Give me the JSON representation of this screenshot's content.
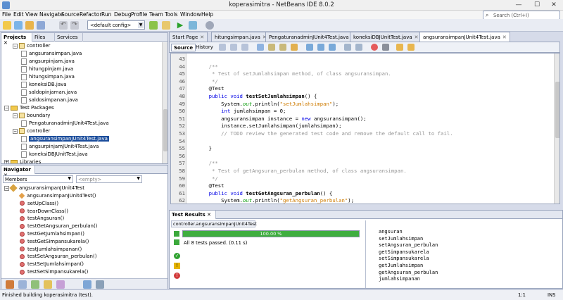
{
  "window": {
    "title": "koperasimitra - NetBeans IDE 8.0.2",
    "min": "—",
    "max": "☐",
    "close": "✕"
  },
  "menu": [
    "File",
    "Edit",
    "View",
    "Navigate",
    "Source",
    "Refactor",
    "Run",
    "Debug",
    "Profile",
    "Team",
    "Tools",
    "Window",
    "Help"
  ],
  "search": {
    "placeholder": "Search (Ctrl+I)"
  },
  "toolbar": {
    "config": "<default config>"
  },
  "projects_panel": {
    "tabs": [
      "Projects",
      "Files",
      "Services"
    ],
    "rows": [
      {
        "label": "controller",
        "type": "pkg",
        "indent": 2
      },
      {
        "label": "angsuransimpan.java",
        "type": "file",
        "indent": 3
      },
      {
        "label": "angsurpinjam.java",
        "type": "file",
        "indent": 3
      },
      {
        "label": "hitungpinjam.java",
        "type": "file",
        "indent": 3
      },
      {
        "label": "hitungsimpan.java",
        "type": "file",
        "indent": 3
      },
      {
        "label": "koneksiDB.java",
        "type": "file",
        "indent": 3
      },
      {
        "label": "saldopinjaman.java",
        "type": "file",
        "indent": 3
      },
      {
        "label": "saldosimpanan.java",
        "type": "file",
        "indent": 3
      },
      {
        "label": "Test Packages",
        "type": "folder",
        "indent": 1
      },
      {
        "label": "boundary",
        "type": "pkg",
        "indent": 2
      },
      {
        "label": "PengaturanadminJUnit4Test.java",
        "type": "file",
        "indent": 3
      },
      {
        "label": "controller",
        "type": "pkg",
        "indent": 2
      },
      {
        "label": "angsuransimpanJUnit4Test.java",
        "type": "file",
        "indent": 3,
        "selected": true
      },
      {
        "label": "angsurpinjamJUnit4Test.java",
        "type": "file",
        "indent": 3
      },
      {
        "label": "koneksiDBJUnitTest.java",
        "type": "file",
        "indent": 3
      },
      {
        "label": "Libraries",
        "type": "folder",
        "indent": 1
      }
    ]
  },
  "navigator": {
    "title": "Navigator",
    "members_label": "Members",
    "filter": "<empty>",
    "class_name": "angsuransimpanJUnit4Test",
    "items": [
      "angsuransimpanJUnit4Test()",
      "setUpClass()",
      "tearDownClass()",
      "testAngsuran()",
      "testGetAngsuran_perbulan()",
      "testGetJumlahsimpan()",
      "testGetSimpansukarela()",
      "testJumlahsimpanan()",
      "testSetAngsuran_perbulan()",
      "testSetJumlahsimpan()",
      "testSetSimpansukarela()"
    ]
  },
  "editor": {
    "tabs": [
      "Start Page",
      "hitungsimpan.java",
      "PengaturanadminJUnit4Test.java",
      "koneksiDBJUnitTest.java",
      "angsuransimpanJUnit4Test.java"
    ],
    "active_tab": 4,
    "sub_tabs": [
      "Source",
      "History"
    ],
    "lines": [
      {
        "n": "43",
        "parts": [
          {
            "t": "",
            "c": ""
          }
        ]
      },
      {
        "n": "44",
        "parts": [
          {
            "t": "    /**",
            "c": "c"
          }
        ]
      },
      {
        "n": "45",
        "parts": [
          {
            "t": "     * Test of setJumlahsimpan method, of class angsuransimpan.",
            "c": "c"
          }
        ]
      },
      {
        "n": "46",
        "parts": [
          {
            "t": "     */",
            "c": "c"
          }
        ]
      },
      {
        "n": "47",
        "parts": [
          {
            "t": "    @Test",
            "c": ""
          }
        ]
      },
      {
        "n": "48",
        "parts": [
          {
            "t": "    public void ",
            "c": "k"
          },
          {
            "t": "testSetJumlahsimpan",
            "c": "m"
          },
          {
            "t": "() {",
            "c": ""
          }
        ]
      },
      {
        "n": "49",
        "parts": [
          {
            "t": "        System.",
            "c": ""
          },
          {
            "t": "out",
            "c": "f"
          },
          {
            "t": ".println(",
            "c": ""
          },
          {
            "t": "\"setJumlahsimpan\"",
            "c": "s"
          },
          {
            "t": ");",
            "c": ""
          }
        ]
      },
      {
        "n": "50",
        "parts": [
          {
            "t": "        ",
            "c": ""
          },
          {
            "t": "int",
            "c": "k"
          },
          {
            "t": " jumlahsimpan = 0;",
            "c": ""
          }
        ]
      },
      {
        "n": "51",
        "parts": [
          {
            "t": "        angsuransimpan instance = ",
            "c": ""
          },
          {
            "t": "new",
            "c": "k"
          },
          {
            "t": " angsuransimpan();",
            "c": ""
          }
        ]
      },
      {
        "n": "52",
        "parts": [
          {
            "t": "        instance.setJumlahsimpan(jumlahsimpan);",
            "c": ""
          }
        ]
      },
      {
        "n": "53",
        "parts": [
          {
            "t": "        // TODO review the generated test code and remove the default call to fail.",
            "c": "c"
          }
        ]
      },
      {
        "n": "54",
        "parts": [
          {
            "t": "",
            "c": ""
          }
        ]
      },
      {
        "n": "55",
        "parts": [
          {
            "t": "    }",
            "c": ""
          }
        ]
      },
      {
        "n": "56",
        "parts": [
          {
            "t": "",
            "c": ""
          }
        ]
      },
      {
        "n": "57",
        "parts": [
          {
            "t": "    /**",
            "c": "c"
          }
        ]
      },
      {
        "n": "58",
        "parts": [
          {
            "t": "     * Test of getAngsuran_perbulan method, of class angsuransimpan.",
            "c": "c"
          }
        ]
      },
      {
        "n": "59",
        "parts": [
          {
            "t": "     */",
            "c": "c"
          }
        ]
      },
      {
        "n": "60",
        "parts": [
          {
            "t": "    @Test",
            "c": ""
          }
        ]
      },
      {
        "n": "61",
        "parts": [
          {
            "t": "    public void ",
            "c": "k"
          },
          {
            "t": "testGetAngsuran_perbulan",
            "c": "m"
          },
          {
            "t": "() {",
            "c": ""
          }
        ]
      },
      {
        "n": "62",
        "parts": [
          {
            "t": "        System.",
            "c": ""
          },
          {
            "t": "out",
            "c": "f"
          },
          {
            "t": ".println(",
            "c": ""
          },
          {
            "t": "\"getAngsuran_perbulan\"",
            "c": "s"
          },
          {
            "t": ");",
            "c": ""
          }
        ]
      }
    ]
  },
  "results": {
    "title": "Test Results",
    "tab": "controller.angsuransimpanJUnit4Test",
    "progress_label": "100.00 %",
    "progress_value": 1.0,
    "summary": "All 8 tests passed. (0.11 s)",
    "output": [
      "angsuran",
      "setJumlahsimpan",
      "setAngsuran_perbulan",
      "getSimpansukarela",
      "setSimpansukarela",
      "getJumlahsimpan",
      "getAngsuran_perbulan",
      "jumlahsimpanan"
    ]
  },
  "status": {
    "message": "Finished building koperasimitra (test).",
    "position": "1:1",
    "mode": "INS"
  }
}
